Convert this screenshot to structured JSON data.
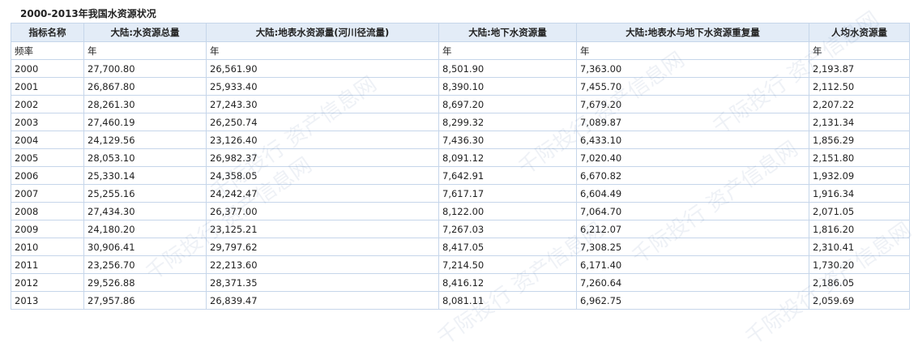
{
  "title": "2000-2013年我国水资源状况",
  "columns": [
    "指标名称",
    "大陆:水资源总量",
    "大陆:地表水资源量(河川径流量)",
    "大陆:地下水资源量",
    "大陆:地表水与地下水资源重复量",
    "人均水资源量"
  ],
  "freq_row": [
    "频率",
    "年",
    "年",
    "年",
    "年",
    "年"
  ],
  "rows": [
    [
      "2000",
      "27,700.80",
      "26,561.90",
      "8,501.90",
      "7,363.00",
      "2,193.87"
    ],
    [
      "2001",
      "26,867.80",
      "25,933.40",
      "8,390.10",
      "7,455.70",
      "2,112.50"
    ],
    [
      "2002",
      "28,261.30",
      "27,243.30",
      "8,697.20",
      "7,679.20",
      "2,207.22"
    ],
    [
      "2003",
      "27,460.19",
      "26,250.74",
      "8,299.32",
      "7,089.87",
      "2,131.34"
    ],
    [
      "2004",
      "24,129.56",
      "23,126.40",
      "7,436.30",
      "6,433.10",
      "1,856.29"
    ],
    [
      "2005",
      "28,053.10",
      "26,982.37",
      "8,091.12",
      "7,020.40",
      "2,151.80"
    ],
    [
      "2006",
      "25,330.14",
      "24,358.05",
      "7,642.91",
      "6,670.82",
      "1,932.09"
    ],
    [
      "2007",
      "25,255.16",
      "24,242.47",
      "7,617.17",
      "6,604.49",
      "1,916.34"
    ],
    [
      "2008",
      "27,434.30",
      "26,377.00",
      "8,122.00",
      "7,064.70",
      "2,071.05"
    ],
    [
      "2009",
      "24,180.20",
      "23,125.21",
      "7,267.03",
      "6,212.07",
      "1,816.20"
    ],
    [
      "2010",
      "30,906.41",
      "29,797.62",
      "8,417.05",
      "7,308.25",
      "2,310.41"
    ],
    [
      "2011",
      "23,256.70",
      "22,213.60",
      "7,214.50",
      "6,171.40",
      "1,730.20"
    ],
    [
      "2012",
      "29,526.88",
      "28,371.35",
      "8,416.12",
      "7,260.64",
      "2,186.05"
    ],
    [
      "2013",
      "27,957.86",
      "26,839.47",
      "8,081.11",
      "6,962.75",
      "2,059.69"
    ]
  ],
  "watermark_text": "千际投行 资产信息网"
}
